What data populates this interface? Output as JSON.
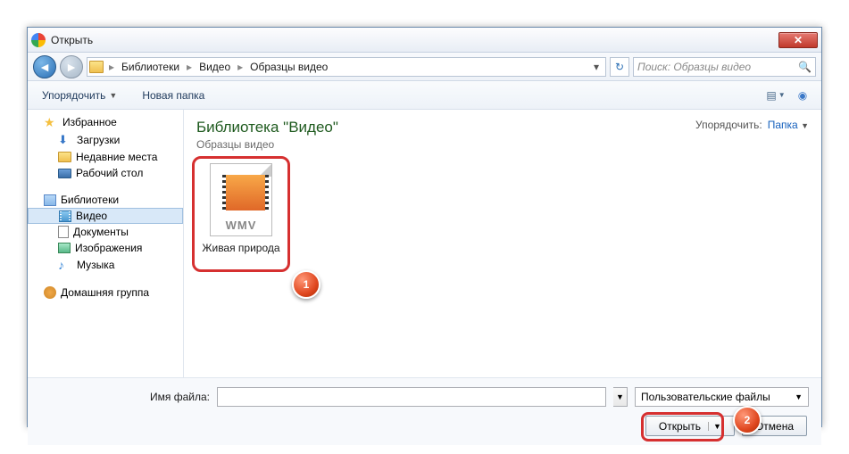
{
  "window": {
    "title": "Открыть"
  },
  "breadcrumb": {
    "items": [
      "Библиотеки",
      "Видео",
      "Образцы видео"
    ]
  },
  "search": {
    "placeholder": "Поиск: Образцы видео"
  },
  "toolbar": {
    "organize": "Упорядочить",
    "new_folder": "Новая папка"
  },
  "sidebar": {
    "favorites": {
      "label": "Избранное",
      "items": [
        "Загрузки",
        "Недавние места",
        "Рабочий стол"
      ]
    },
    "libraries": {
      "label": "Библиотеки",
      "items": [
        "Видео",
        "Документы",
        "Изображения",
        "Музыка"
      ]
    },
    "homegroup": {
      "label": "Домашняя группа"
    }
  },
  "content": {
    "library_title": "Библиотека \"Видео\"",
    "library_subtitle": "Образцы видео",
    "arrange_label": "Упорядочить:",
    "arrange_value": "Папка",
    "files": [
      {
        "name": "Живая природа",
        "ext": "WMV"
      }
    ]
  },
  "footer": {
    "filename_label": "Имя файла:",
    "filename_value": "",
    "filter": "Пользовательские файлы",
    "open": "Открыть",
    "cancel": "Отмена"
  },
  "badges": {
    "b1": "1",
    "b2": "2"
  }
}
